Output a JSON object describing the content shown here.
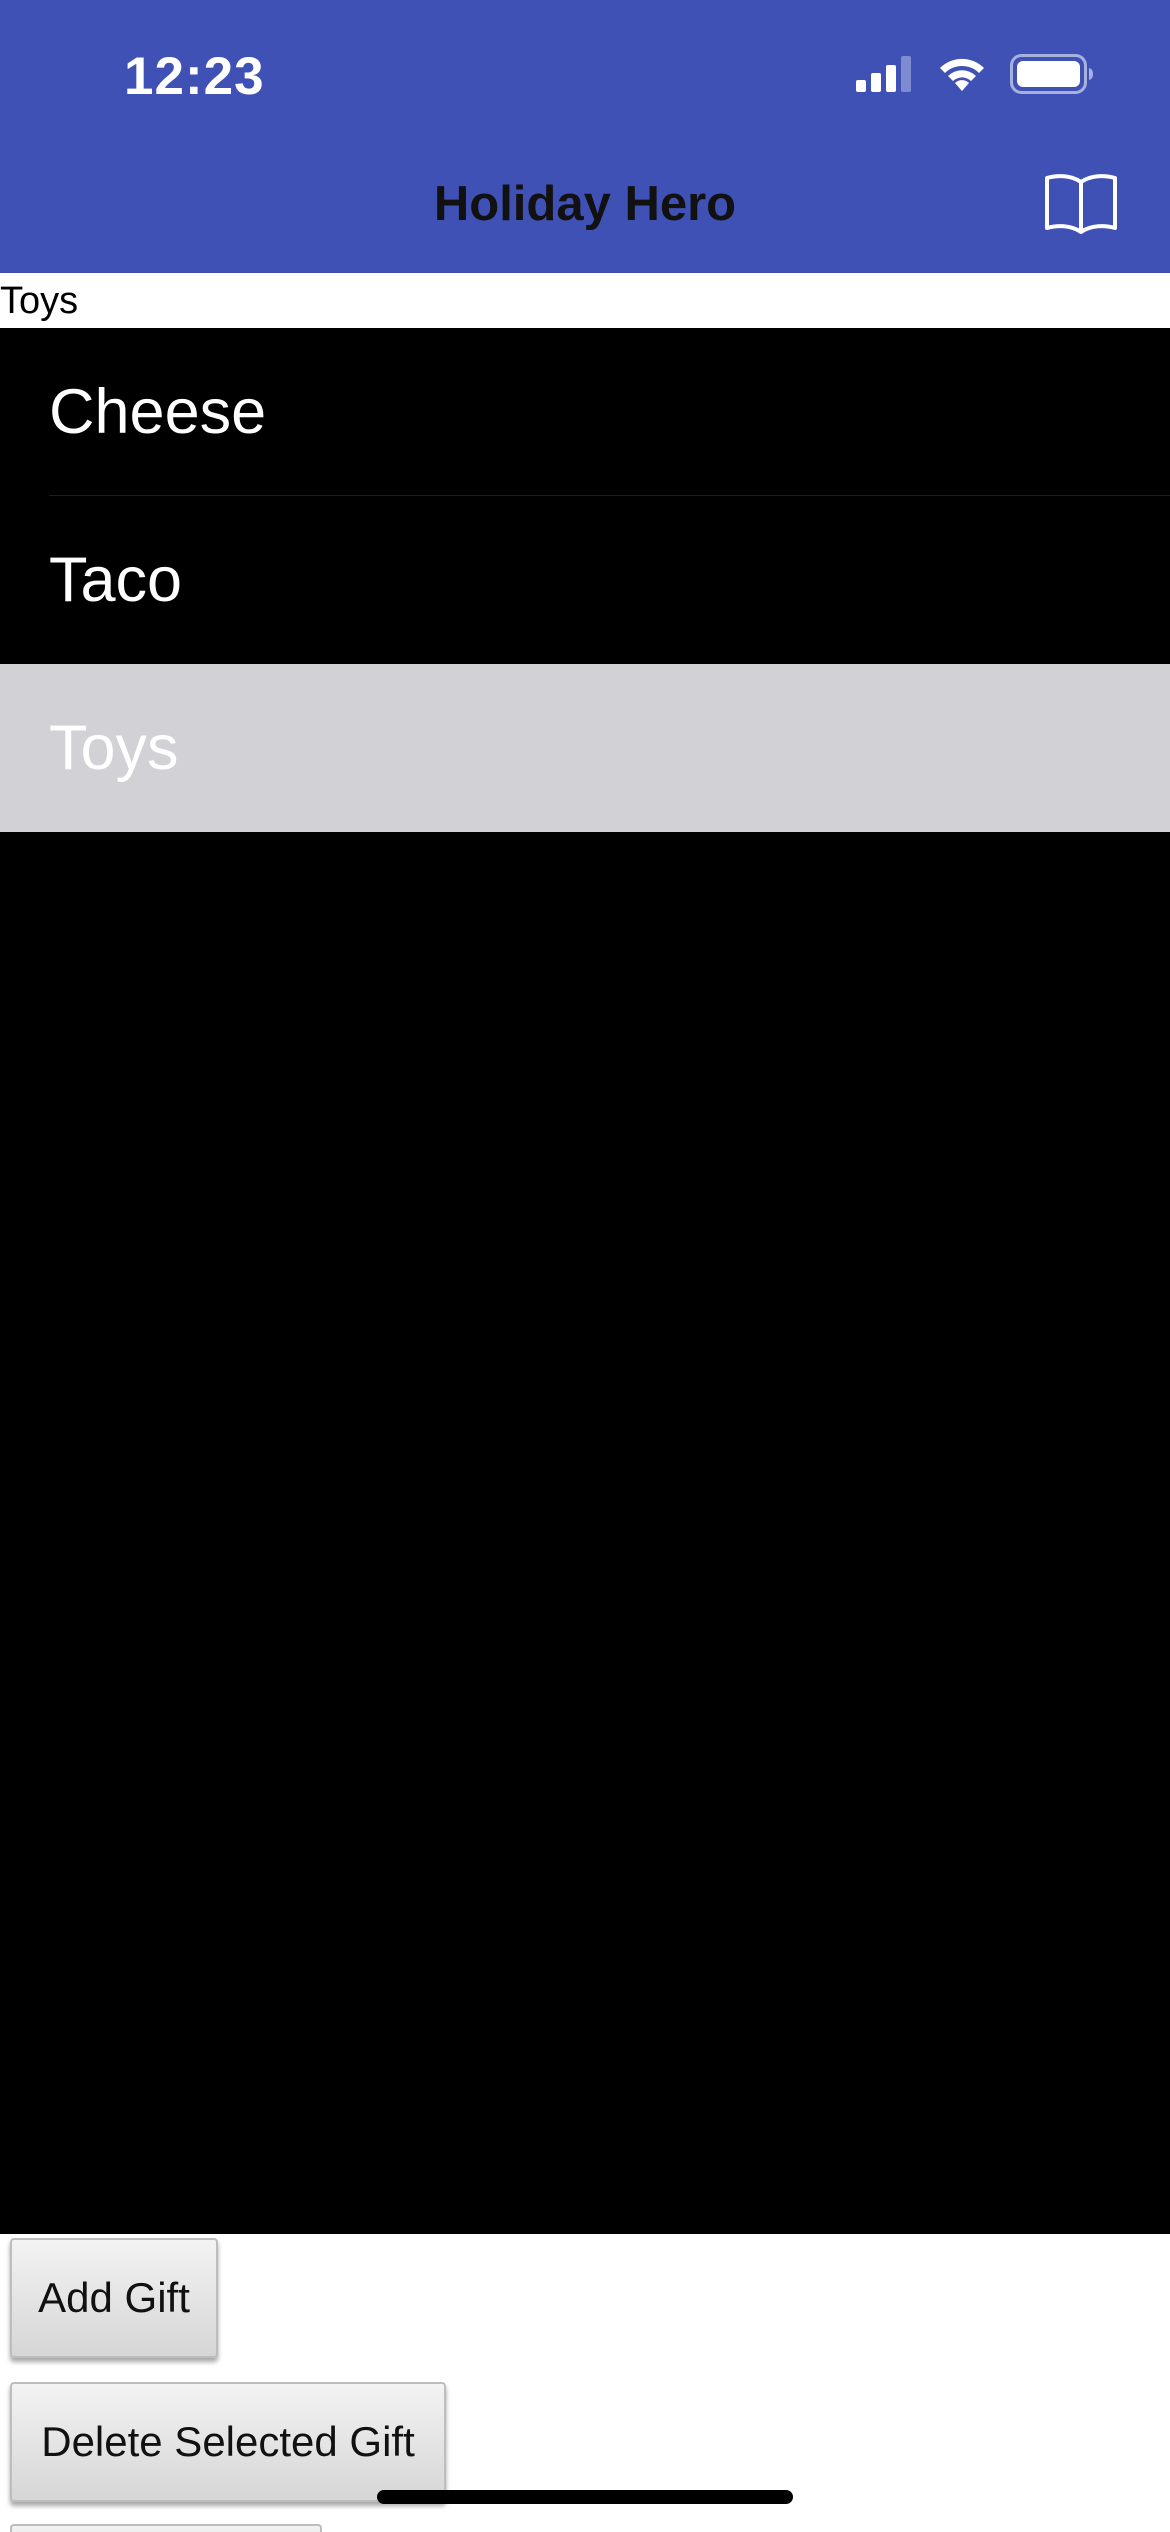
{
  "status_bar": {
    "time": "12:23",
    "icons": [
      "cellular-signal-icon",
      "wifi-icon",
      "battery-icon"
    ]
  },
  "nav": {
    "title": "Holiday Hero",
    "right_icon": "book-icon"
  },
  "selected_label": "Toys",
  "list": {
    "items": [
      {
        "label": "Cheese"
      },
      {
        "label": "Taco"
      },
      {
        "label": "Toys"
      }
    ],
    "selected_index": 2
  },
  "buttons": {
    "add_label": "Add Gift",
    "delete_label": "Delete Selected Gift"
  },
  "colors": {
    "header": "#3f51b5",
    "list_background": "#000000",
    "selected_row": "#d1d1d6"
  }
}
